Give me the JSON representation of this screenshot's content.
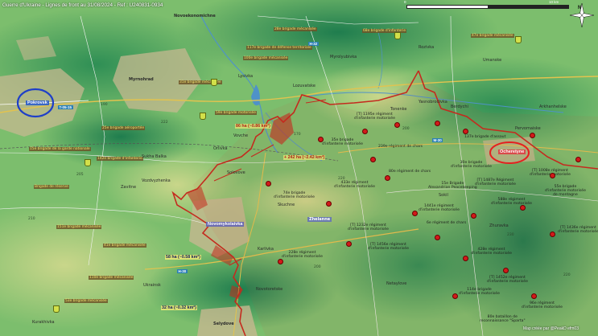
{
  "title": "Guerre d'Ukraine - Lignes de front au 31/08/2024 - Ref : U240831-0934",
  "scale": {
    "start": "0",
    "end": "10 km"
  },
  "compass": "N",
  "credit": "Map créée par @PeakD​ efm03",
  "colors": {
    "ru_front": "#c42a1e",
    "ua_marker": "#d8e84a",
    "ru_marker": "#d21a1a",
    "circle_blue": "#1e3fc8",
    "circle_red": "#e52020",
    "water": "#4f92c8",
    "road": "#e3c34e"
  },
  "cities": {
    "pokrovsk": "Pokrovsk",
    "novohrodivka": "Novohrodivka",
    "novomykolaivka": "Novomykolaivka",
    "krasnohorivka": "Krasnohorivka",
    "selydove": "Selydove",
    "ocheretyne": "Ocheretyne",
    "zhelanne": "Zhelanne",
    "myrnohrad": "Myrnohrad",
    "hrodivka": "Hrodivka"
  },
  "roads": {
    "r1": "T-05-15",
    "r2": "H-32",
    "r3": "H-30",
    "r4": "M-30"
  },
  "gains": {
    "g1": "86 ha (~0.86 km²)",
    "g2": "+ 242 ha (~2.42 km²)",
    "g3": "58 ha (~0.58 km²)",
    "g4": "32 ha (~0.32 km²)"
  },
  "ua_units": {
    "u1": "28e brigade mécanisée",
    "u2": "68e brigade d'infanterie",
    "u3": "47e brigade mécanisée",
    "u4": "100e brigade mécanisée",
    "u5": "31e brigade mécanisée",
    "u6": "59e brigade motorisée",
    "u7": "25e brigade aéroportée",
    "u8": "15e brigade de la garde nationale",
    "u9": "142e brigade d'infanterie",
    "u10": "151e brigade mécanisée",
    "u11": "110e brigade mécanisée",
    "u12": "53e brigade mécanisée",
    "u13": "117e brigade de défense territoriale",
    "u14": "41e brigade mécanisée",
    "u15": "Brigade de réserve"
  },
  "ru_units": {
    "r1": "[T] 1195e régiment\nd'infanterie motorisée",
    "r2": "35e brigade\nd'infanterie motorisée",
    "r3": "239e régiment de chars",
    "r4": "137e brigade d'assaut",
    "r5": "30e brigade\nd'infanterie motorisée",
    "r6": "74e brigade\nd'infanterie motorisée",
    "r7": "433e régiment\nd'infanterie motorisée",
    "r8": "80e régiment de chars",
    "r9": "1441e régiment\nd'infanterie motorisée",
    "r10": "6e régiment de chars",
    "r11": "15e Brigade\nAlexandrian Peacekeeping",
    "r12": "[T] 1232e régiment\nd'infanterie motorisée",
    "r13": "[T] 1487e Régiment\nd'infanterie motorisée",
    "r14": "588e régiment\nd'infanterie motorisée",
    "r15": "[T] 1436e régiment\nd'infanterie motorisée",
    "r16": "55e brigade\nd'infanterie motorisée\nde montagne",
    "r17": "[T] 1456e régiment\nd'infanterie motorisée",
    "r18": "228e régiment\nd'infanterie motorisée",
    "r19": "428e régiment\nd'infanterie motorisée",
    "r20": "[T] 1452e régiment\nd'infanterie motorisée",
    "r21": "114e brigade\nd'infanterie motorisée",
    "r22": "[T] 1008e régiment\nd'infanterie motorisée",
    "r23": "96e régiment\nd'infanterie motorisée",
    "r24": "80e bataillon de\nreconnaissance \"Sparta\"",
    "r25": "30e régiment\nd'infanterie motorisée",
    "r26": "[T] 1310e régiment\nd'infanterie motorisée",
    "r27": "[T] 1194e régiment\nd'infanterie motorisée",
    "r28": "39e brigade\nd'infanterie motorisée"
  },
  "villages": {
    "v1": "Novoekonomichne",
    "v2": "Sukhyi Yar",
    "v3": "Myrolyubivka",
    "v4": "Lysivka",
    "v5": "Sukha Balka",
    "v6": "Rozivka",
    "v7": "Vovche",
    "v8": "Orlivka",
    "v9": "Tonenke",
    "v10": "Umanske",
    "v11": "Vozdvyzhenka",
    "v12": "Solovove",
    "v13": "Karlivka",
    "v14": "Prohres",
    "v15": "Lozuvatske",
    "v16": "Hrodivka",
    "v17": "Zavitne",
    "v18": "Memryk",
    "v19": "Kalynove",
    "v20": "Skuchne",
    "v21": "Novozhelanne",
    "v22": "Sokil",
    "v23": "Novobakhmutivka",
    "v24": "Novoselivka Persha",
    "v25": "Keramik",
    "v26": "Berdychi",
    "v27": "Arkhanhelske",
    "v28": "Yasnobrodivka",
    "v29": "Netaylove",
    "v30": "Pervomaiske",
    "v31": "Tsukuryne",
    "v32": "Mykolaivka",
    "v33": "Kurakhivka",
    "v34": "Zhuravka",
    "v35": "Lysychne",
    "v36": "Novotoretske",
    "v37": "Kirove",
    "v38": "Marynivka",
    "v39": "Ukrainsk",
    "v40": "Halytsynivka"
  }
}
